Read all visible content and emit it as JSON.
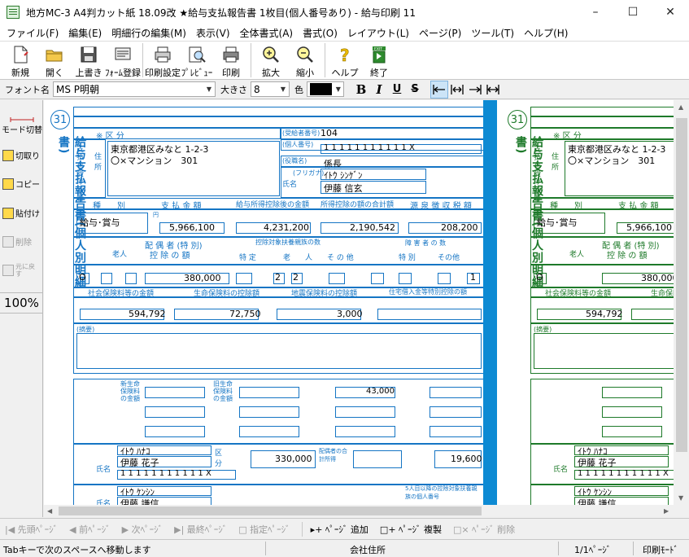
{
  "window": {
    "title": "地方MC-3 A4判カット紙 18.09改 ★給与支払報告書 1枚目(個人番号あり) - 給与印刷 11"
  },
  "menu": [
    "ファイル(F)",
    "編集(E)",
    "明細行の編集(M)",
    "表示(V)",
    "全体書式(A)",
    "書式(O)",
    "レイアウト(L)",
    "ページ(P)",
    "ツール(T)",
    "ヘルプ(H)"
  ],
  "toolbar": [
    {
      "name": "new",
      "label": "新規"
    },
    {
      "name": "open",
      "label": "開く"
    },
    {
      "name": "save",
      "label": "上書き"
    },
    {
      "name": "form-register",
      "label": "ﾌｫｰﾑ登録"
    },
    {
      "name": "print-settings",
      "label": "印刷設定"
    },
    {
      "name": "preview",
      "label": "ﾌﾟﾚﾋﾞｭｰ"
    },
    {
      "name": "print",
      "label": "印刷"
    },
    {
      "name": "zoom-in",
      "label": "拡大"
    },
    {
      "name": "zoom-out",
      "label": "縮小"
    },
    {
      "name": "help",
      "label": "ヘルプ"
    },
    {
      "name": "exit",
      "label": "終了"
    }
  ],
  "fontbar": {
    "font_label": "フォント名",
    "font_value": "MS P明朝",
    "size_label": "大きさ",
    "size_value": "8",
    "color_label": "色",
    "bold": "B",
    "italic": "I",
    "underline": "U",
    "strike": "S"
  },
  "leftpanel": {
    "mode": "モード切替",
    "cut": "切取り",
    "copy": "コピー",
    "paste": "貼付け",
    "delete": "削除",
    "undo": "元に戻す",
    "zoom": "100%"
  },
  "form": {
    "circle_number": "31",
    "vertical_title": "給与支払報告書(個人別明細書)",
    "labels": {
      "kubun": "※ 区 分",
      "payee_to": "支払を受ける者",
      "address_label": "住所",
      "receiver_num": "(受給者番号)",
      "personal_num": "(個人番号)",
      "position": "(役職名)",
      "name_label": "氏名",
      "furigana": "(フリガナ)",
      "shubetsu": "種　　別",
      "shiharai": "支 払 金 額",
      "kyuyo_shotoku": "給与所得控除後の金額",
      "shotoku_kojo": "所得控除の額の合計額",
      "gensen": "源 泉 徴 収 税 額",
      "haigusha": "配 偶 者 (特 別)",
      "kojo_gaku": "控 除 の 額",
      "rojin": "老人",
      "fuyo": "控除対象扶養親族の数",
      "tokutei": "特 定",
      "rojin2": "老　　人",
      "sonota": "そ の 他",
      "shogaisha": "障 害 者 の 数",
      "tokubetsu": "特 別",
      "sonota2": "その他",
      "shakai": "社会保険料等の金額",
      "seimei": "生命保険料の控除額",
      "jishin": "地震保険料の控除額",
      "jutaku": "住宅借入金等特別控除の額",
      "tekiyo": "(摘要)",
      "shin_seimei": "新生命保険料の金額",
      "kyu_seimei": "旧生命保険料の金額",
      "haigusha_gokei": "配偶者の合計所得",
      "yen": "円",
      "kubun_short": "区分",
      "row5_note": "5人目以降の控除対象扶養親族の個人番号"
    },
    "receiver_number": "104",
    "personal_number": "1 1 1 1 1 1 1 1 1 1 1 X",
    "address_line1": "東京都港区みなと 1-2-3",
    "address_line2": "〇×マンション　301",
    "position": "係長",
    "name_kana": "ｲﾄｳ ｼﾝｹﾞﾝ",
    "name": "伊藤 信玄",
    "shubetsu": "給与･賞与",
    "shiharai_kingaku": "5,966,100",
    "kyuyo_shotoku_kojogo": "4,231,200",
    "shotoku_kojo_gokei": "2,190,542",
    "gensen_choshu": "208,200",
    "haigusha_mark": "O",
    "haigusha_kojo": "380,000",
    "rojin_count": "2",
    "rojin_count2": "2",
    "shogai_sonota": "1",
    "shakai_hoken": "594,792",
    "seimei_hoken": "72,750",
    "jishin_hoken": "3,000",
    "kyu_seimei_amount": "43,000",
    "haigusha_gokei_amount": "19,600",
    "spouse_kana": "ｲﾄｳ ﾊﾅｺ",
    "spouse_name": "伊藤 花子",
    "spouse_number": "1 1 1 1 1 1 1 1 1 1 1 X",
    "spouse_income": "330,000",
    "dep1_kana": "ｲﾄｳ ｹﾝｼﾝ",
    "dep1_name": "伊藤 謙信"
  },
  "navbar": {
    "first": "先頭ﾍﾟｰｼﾞ",
    "prev": "前ﾍﾟｰｼﾞ",
    "next": "次ﾍﾟｰｼﾞ",
    "last": "最終ﾍﾟｰｼﾞ",
    "goto": "指定ﾍﾟｰｼﾞ",
    "add": "ﾍﾟｰｼﾞ 追加",
    "copy": "ﾍﾟｰｼﾞ 複製",
    "delete": "ﾍﾟｰｼﾞ 削除"
  },
  "status": {
    "hint": "Tabキーで次のスペースへ移動します",
    "field": "会社住所",
    "page": "1/1ﾍﾟｰｼﾞ",
    "mode": "印刷ﾓｰﾄﾞ"
  }
}
